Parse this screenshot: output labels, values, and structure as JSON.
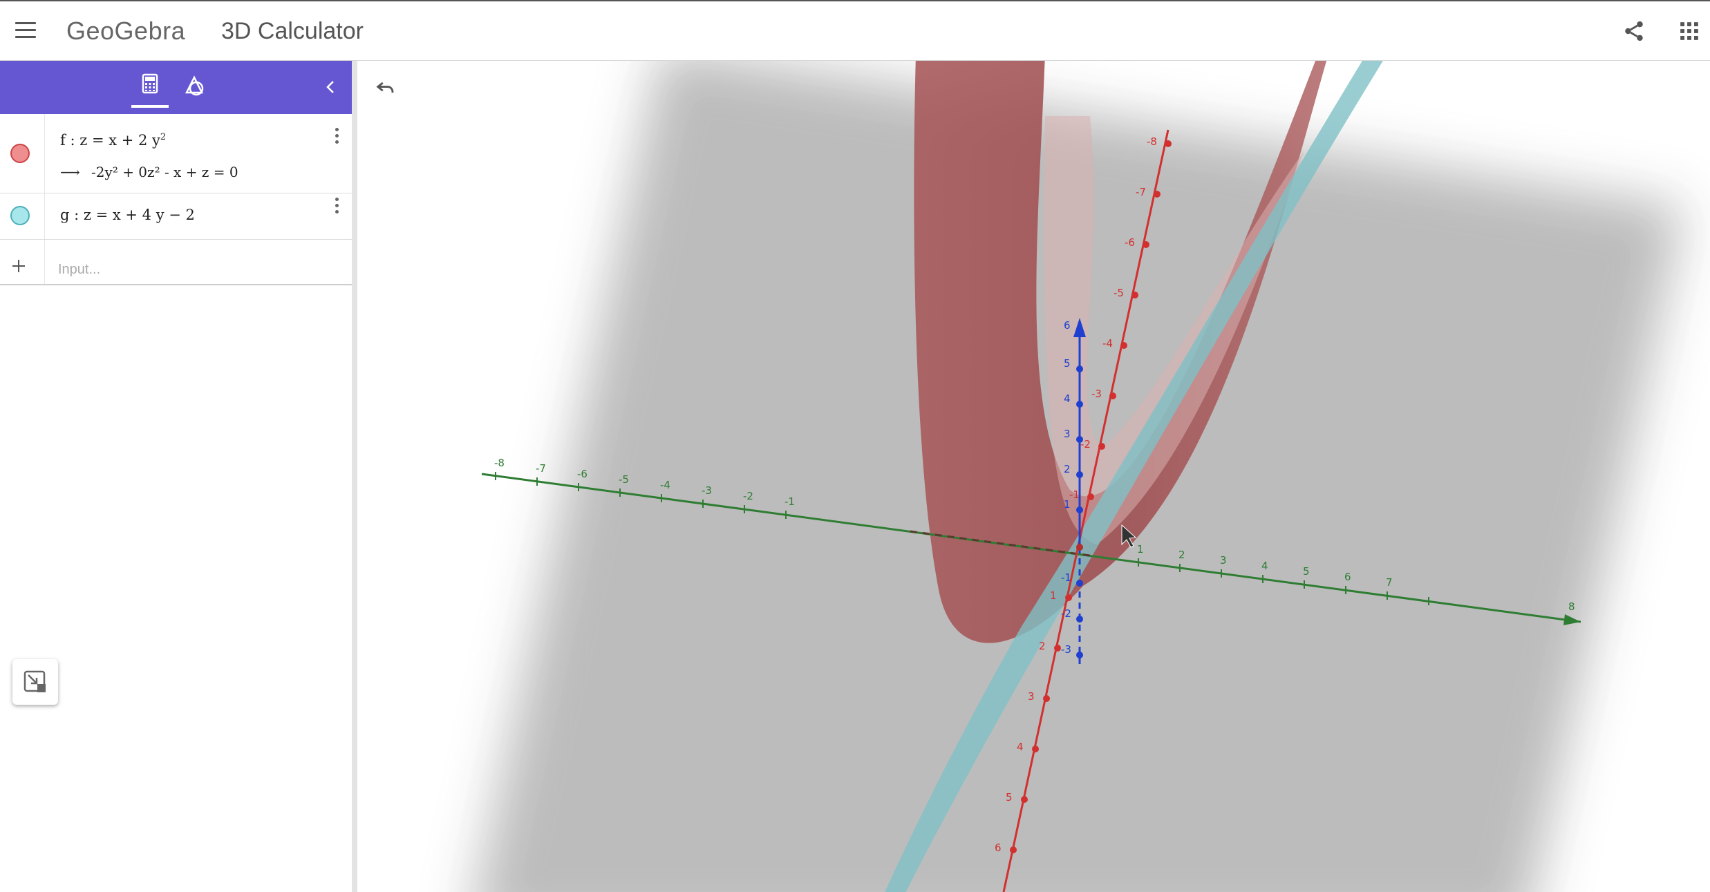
{
  "header": {
    "logo_text": "GeoGebra",
    "app_title": "3D Calculator",
    "menu_icon": "hamburger-menu-icon",
    "share_icon": "share-icon",
    "apps_icon": "apps-grid-icon"
  },
  "panel": {
    "tabs": [
      {
        "name": "algebra",
        "icon": "calculator-icon",
        "selected": true
      },
      {
        "name": "tools",
        "icon": "tools-icon",
        "selected": false
      }
    ],
    "collapse_icon": "chevron-left-icon",
    "accent_color": "#6557d2",
    "objects": [
      {
        "name": "f",
        "color": "#e57373",
        "definition": "f : z = x + 2 y",
        "definition_exponent": "2",
        "output": "-2y² + 0z² - x + z = 0",
        "output_arrow": "⟶"
      },
      {
        "name": "g",
        "color": "#7fd6dc",
        "definition": "g : z = x + 4 y − 2"
      }
    ],
    "input_placeholder": "Input...",
    "add_icon": "plus-icon",
    "style_bar_icon": "style-bar-toggle-icon"
  },
  "graphics": {
    "undo_icon": "undo-icon",
    "x_axis_color": "#2e7d32",
    "y_axis_color": "#d32f2f",
    "z_axis_color": "#1e3fd0",
    "x_tick_labels": [
      "-8",
      "-7",
      "-6",
      "-5",
      "-4",
      "-3",
      "-2",
      "-1",
      "1",
      "2",
      "3",
      "4",
      "5",
      "6",
      "7",
      "8"
    ],
    "y_tick_labels": [
      "-8",
      "-7",
      "-6",
      "-5",
      "-4",
      "-3",
      "-2",
      "-1",
      "1",
      "2",
      "3",
      "4",
      "5",
      "6"
    ],
    "z_tick_labels": [
      "6",
      "5",
      "4",
      "3",
      "2",
      "1",
      "-1",
      "-2",
      "-3"
    ]
  }
}
